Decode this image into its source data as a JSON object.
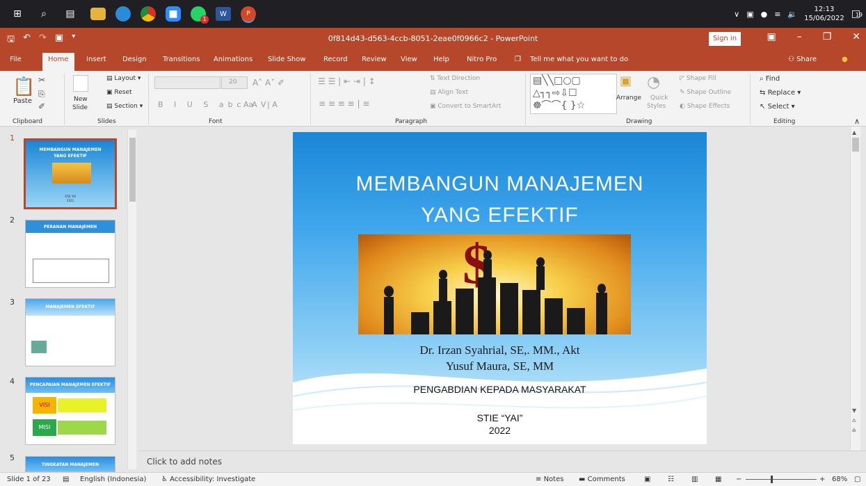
{
  "titlebar": {
    "title": "0f814d43-d563-4ccb-8051-2eae0f0966c2 - PowerPoint",
    "signin": "Sign in"
  },
  "taskbar": {
    "time": "12:13",
    "date": "15/06/2022",
    "notif_count": "19",
    "whatsapp_badge": "1"
  },
  "tabs": [
    "File",
    "Home",
    "Insert",
    "Design",
    "Transitions",
    "Animations",
    "Slide Show",
    "Record",
    "Review",
    "View",
    "Help",
    "Nitro Pro"
  ],
  "tellme": "Tell me what you want to do",
  "share": "Share",
  "ribbon": {
    "clipboard": {
      "paste": "Paste",
      "label": "Clipboard"
    },
    "slides": {
      "new_slide": "New",
      "new_slide2": "Slide",
      "layout": "Layout",
      "reset": "Reset",
      "section": "Section",
      "label": "Slides"
    },
    "font": {
      "size": "20",
      "label": "Font",
      "aa": "Aa"
    },
    "paragraph": {
      "text_direction": "Text Direction",
      "align_text": "Align Text",
      "convert": "Convert to SmartArt",
      "label": "Paragraph"
    },
    "drawing": {
      "arrange": "Arrange",
      "quick": "Quick",
      "styles": "Styles",
      "fill": "Shape Fill",
      "outline": "Shape Outline",
      "effects": "Shape Effects",
      "label": "Drawing"
    },
    "editing": {
      "find": "Find",
      "replace": "Replace",
      "select": "Select",
      "label": "Editing"
    }
  },
  "thumbnails": [
    {
      "num": "1",
      "title": "MEMBANGUN MANAJEMEN",
      "title2": "YANG EFEKTIF",
      "footer": "STIE YAI",
      "year": "2022"
    },
    {
      "num": "2",
      "title": "PERANAN MANAJEMEN"
    },
    {
      "num": "3",
      "title": "MANAJEMEN EFEKTIF"
    },
    {
      "num": "4",
      "title": "PENCAPAIAN MANAJEMEN EFEKTIF",
      "visi": "VISI",
      "misi": "MISI"
    },
    {
      "num": "5",
      "title": "TINGKATAN MANAJEMEN"
    }
  ],
  "slide": {
    "title_line1": "MEMBANGUN  MANAJEMEN",
    "title_line2": "YANG  EFEKTIF",
    "author1": "Dr. Irzan Syahrial, SE,. MM., Akt",
    "author2": "Yusuf Maura, SE, MM",
    "program": "PENGABDIAN KEPADA MASYARAKAT",
    "institution": "STIE “YAI”",
    "year": "2022"
  },
  "notes_placeholder": "Click to add notes",
  "status": {
    "slide_count": "Slide 1 of 23",
    "language": "English (Indonesia)",
    "accessibility": "Accessibility: Investigate",
    "notes": "Notes",
    "comments": "Comments",
    "zoom": "68%"
  },
  "colors": {
    "accent": "#b7472a",
    "taskbar": "#1f1f24",
    "ribbon": "#f3f3f3"
  }
}
